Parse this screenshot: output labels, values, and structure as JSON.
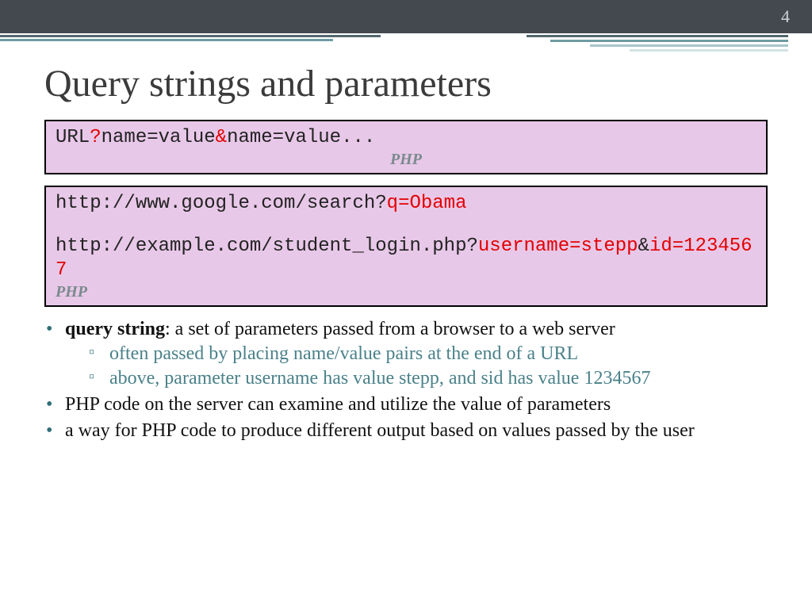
{
  "page_number": "4",
  "title": "Query strings and parameters",
  "codebox1": {
    "part1": "URL",
    "part2": "?",
    "part3": "name=value",
    "part4": "&",
    "part5": "name=value...",
    "label": "PHP"
  },
  "codebox2": {
    "line1a": "http://www.google.com/search?",
    "line1b": "q=Obama",
    "line2a": "http://example.com/student_login.php?",
    "line2b": "username=stepp",
    "line2c": "&",
    "line2d": "id=1234567",
    "label": "PHP"
  },
  "bullets": {
    "b1_bold": "query string",
    "b1_rest": ": a set of parameters passed from a browser to a web server",
    "b1_sub1": "often passed by placing name/value pairs at the end of a URL",
    "b1_sub2": "above, parameter username has value stepp, and sid has value 1234567",
    "b2": "PHP code on the server can examine and utilize the value of parameters",
    "b3": "a way for PHP code to produce different output based on values passed by the user"
  }
}
